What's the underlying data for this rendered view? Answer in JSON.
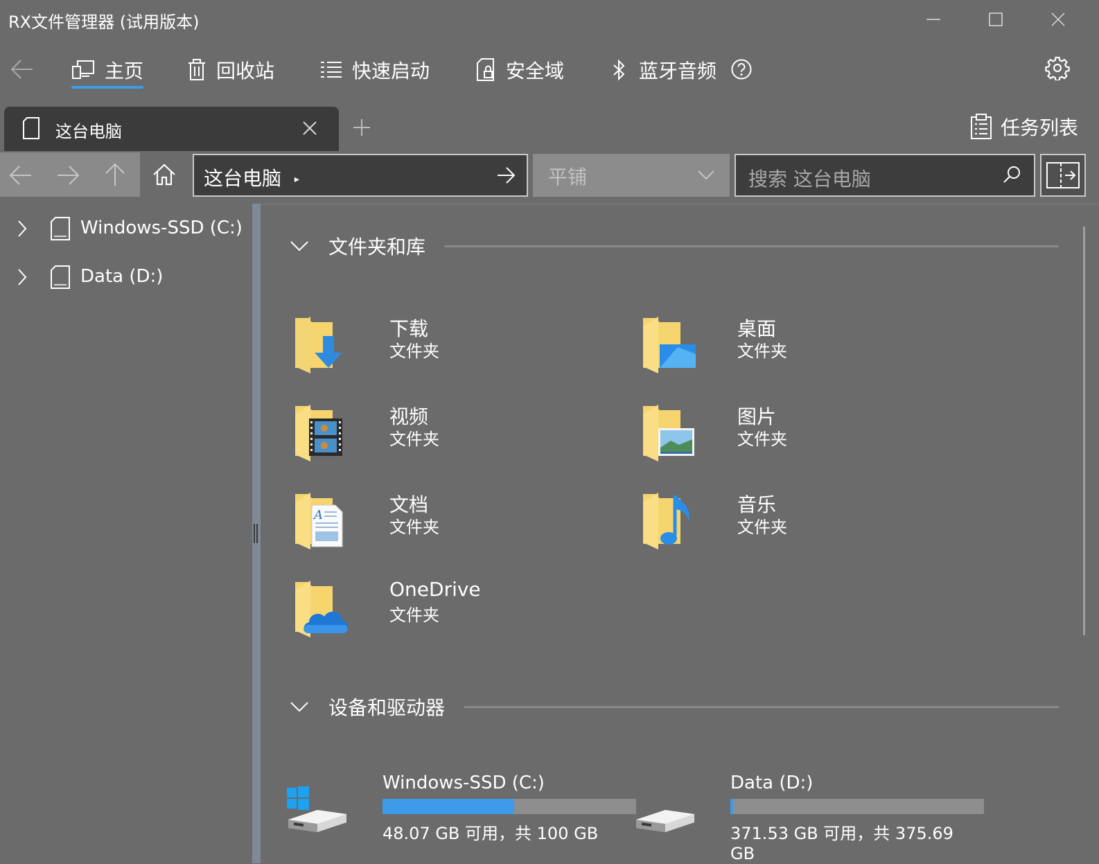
{
  "window": {
    "title": "RX文件管理器 (试用版本)"
  },
  "nav": {
    "items": [
      {
        "label": "主页",
        "icon": "home-screen-icon",
        "active": true
      },
      {
        "label": "回收站",
        "icon": "trash-icon"
      },
      {
        "label": "快速启动",
        "icon": "list-icon"
      },
      {
        "label": "安全域",
        "icon": "lock-file-icon"
      },
      {
        "label": "蓝牙音频",
        "icon": "bluetooth-icon"
      }
    ],
    "help_icon": "help-icon",
    "settings_icon": "gear-icon"
  },
  "tabs": {
    "items": [
      {
        "label": "这台电脑"
      }
    ],
    "tasklist_label": "任务列表"
  },
  "address": {
    "path": "这台电脑",
    "separator": "▸",
    "view_mode": "平铺",
    "search_placeholder": "搜索 这台电脑"
  },
  "sidebar": {
    "items": [
      {
        "label": "Windows-SSD (C:)"
      },
      {
        "label": "Data (D:)"
      }
    ]
  },
  "main": {
    "folders_section": "文件夹和库",
    "folders": [
      {
        "name": "下载",
        "type": "文件夹",
        "overlay": "download"
      },
      {
        "name": "桌面",
        "type": "文件夹",
        "overlay": "desktop"
      },
      {
        "name": "视频",
        "type": "文件夹",
        "overlay": "video"
      },
      {
        "name": "图片",
        "type": "文件夹",
        "overlay": "picture"
      },
      {
        "name": "文档",
        "type": "文件夹",
        "overlay": "document"
      },
      {
        "name": "音乐",
        "type": "文件夹",
        "overlay": "music"
      },
      {
        "name": "OneDrive",
        "type": "文件夹",
        "overlay": "cloud"
      }
    ],
    "drives_section": "设备和驱动器",
    "drives": [
      {
        "name": "Windows-SSD (C:)",
        "free": "48.07 GB 可用，共 100 GB",
        "used_fraction": 0.52,
        "system": true
      },
      {
        "name": "Data (D:)",
        "free": "371.53 GB 可用，共 375.69 GB",
        "used_fraction": 0.011,
        "system": false
      }
    ]
  },
  "colors": {
    "background": "#6b6b6b",
    "accent": "#3d9be9",
    "folder": "#f5d066"
  }
}
